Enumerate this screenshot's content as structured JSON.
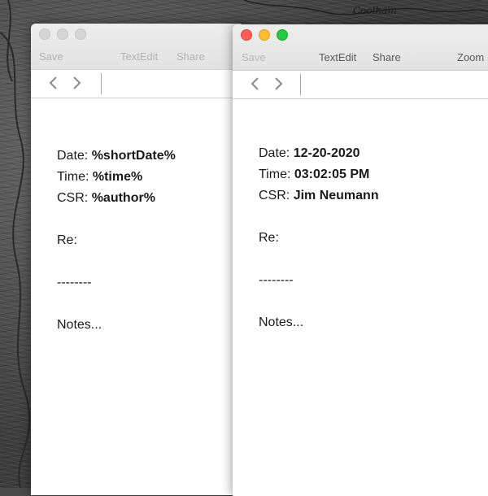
{
  "desktop": {
    "script_text": "Coolham"
  },
  "windows": [
    {
      "id": "template",
      "toolbar": {
        "save": "Save",
        "app": "TextEdit",
        "share": "Share"
      },
      "document": {
        "date_label": "Date:",
        "date_value": "%shortDate%",
        "time_label": "Time:",
        "time_value": "%time%",
        "csr_label": "CSR:",
        "csr_value": "%author%",
        "re_label": "Re:",
        "divider": "--------",
        "notes": "Notes..."
      }
    },
    {
      "id": "filled",
      "toolbar": {
        "save": "Save",
        "app": "TextEdit",
        "share": "Share",
        "zoom": "Zoom"
      },
      "document": {
        "date_label": "Date:",
        "date_value": "12-20-2020",
        "time_label": "Time:",
        "time_value": "03:02:05 PM",
        "csr_label": "CSR:",
        "csr_value": "Jim Neumann",
        "re_label": "Re:",
        "divider": "--------",
        "notes": "Notes..."
      }
    }
  ],
  "colors": {
    "close": "#ff5f57",
    "minimize": "#febc2e",
    "zoom": "#28c840"
  }
}
